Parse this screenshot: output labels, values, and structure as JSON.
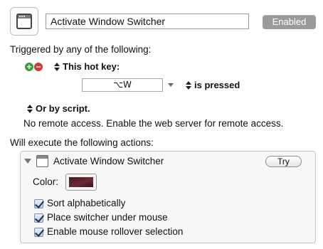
{
  "macro": {
    "name": "Activate Window Switcher",
    "status_button": "Enabled"
  },
  "triggers": {
    "heading": "Triggered by any of the following:",
    "hotkey_label": "This hot key:",
    "hotkey_value": "⌥W",
    "pressed_label": "is pressed",
    "script_label": "Or by script.",
    "remote_text": "No remote access.  Enable the web server for remote access."
  },
  "actions": {
    "heading": "Will execute the following actions:",
    "action_title": "Activate Window Switcher",
    "try_label": "Try",
    "color_label": "Color:",
    "color_value": "#5a2027",
    "options": [
      {
        "label": "Sort alphabetically",
        "checked": true
      },
      {
        "label": "Place switcher under mouse",
        "checked": true
      },
      {
        "label": "Enable mouse rollover selection",
        "checked": true
      }
    ]
  },
  "icons": {
    "app": "window-icon",
    "add": "add-circle-icon",
    "remove": "remove-circle-icon",
    "updown": "up-down-arrows-icon",
    "disclosure": "disclosure-triangle-icon",
    "checkbox": "checkmark-icon"
  }
}
